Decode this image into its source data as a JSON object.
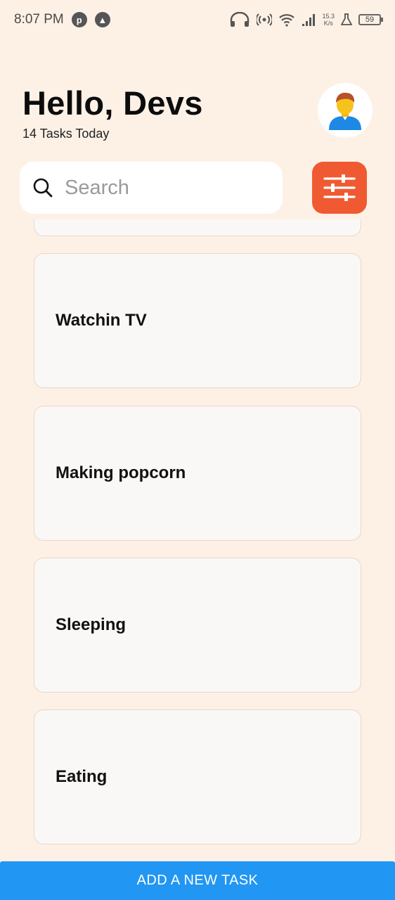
{
  "status_bar": {
    "time": "8:07 PM",
    "net_speed_value": "15.3",
    "net_speed_unit": "K/s",
    "battery": "59",
    "icons": [
      "pinterest-icon",
      "app-icon",
      "headphones-icon",
      "hotspot-icon",
      "wifi-icon",
      "signal-icon",
      "lab-icon",
      "battery-icon"
    ]
  },
  "header": {
    "greeting": "Hello, Devs",
    "task_count": "14 Tasks Today"
  },
  "search": {
    "placeholder": "Search",
    "value": ""
  },
  "filter": {
    "icon": "sliders-icon",
    "color": "#f05a32"
  },
  "tasks": [
    {
      "title": "Watchin TV"
    },
    {
      "title": "Making popcorn"
    },
    {
      "title": "Sleeping"
    },
    {
      "title": "Eating"
    }
  ],
  "add_button": {
    "label": "ADD A NEW TASK",
    "color": "#2196f3"
  },
  "colors": {
    "background": "#fdf1e6",
    "card": "#faf8f6",
    "card_border": "#e8d7c5"
  }
}
